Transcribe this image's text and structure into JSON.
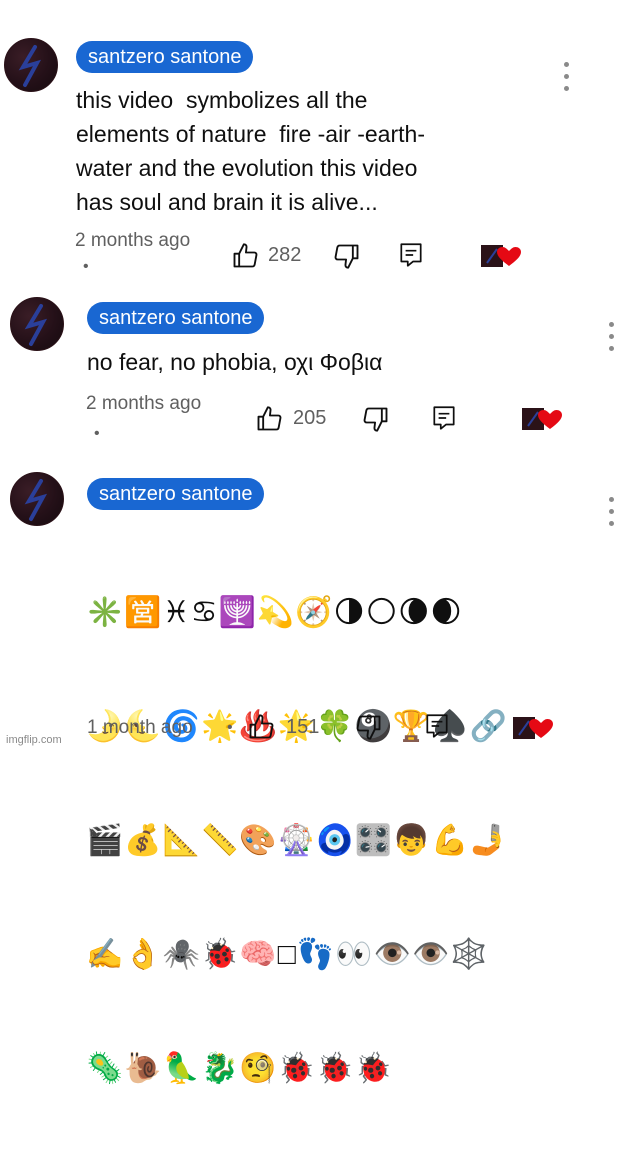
{
  "comments": [
    {
      "author": "santzero santone",
      "body": "this video  symbolizes all the\nelements of nature  fire -air -earth-\nwater and the evolution this video\nhas soul and brain it is alive...",
      "time": "2 months ago",
      "likes": "282"
    },
    {
      "author": "santzero santone",
      "body": "no fear, no phobia, οχι Φοβια",
      "time": "2 months ago",
      "likes": "205"
    },
    {
      "author": "santzero santone",
      "emoji_rows": [
        "✳️🈺♓♋🕎💫🧭🌗🌕🌘🌒",
        "🌛🌜🌀🌟♨️🌟🍀🎱🏆♠️🔗",
        "🎬💰📐📏🎨🎡🧿🎛️👦💪🤳",
        "✍️👌🕷️🐞🧠□👣👀👁️👁️🕸️",
        "🦠🐌🦜🐉🧐🐞🐞🐞"
      ],
      "time": "1 month ago",
      "likes": "151"
    }
  ],
  "icons": {
    "like": "thumbs-up-icon",
    "dislike": "thumbs-down-icon",
    "reply": "reply-icon",
    "menu": "more-vertical-icon",
    "creator_heart": "creator-heart-icon"
  },
  "colors": {
    "author_chip": "#1967d2",
    "heart": "#e50914",
    "secondary_text": "#606060"
  },
  "watermark": "imgflip.com"
}
